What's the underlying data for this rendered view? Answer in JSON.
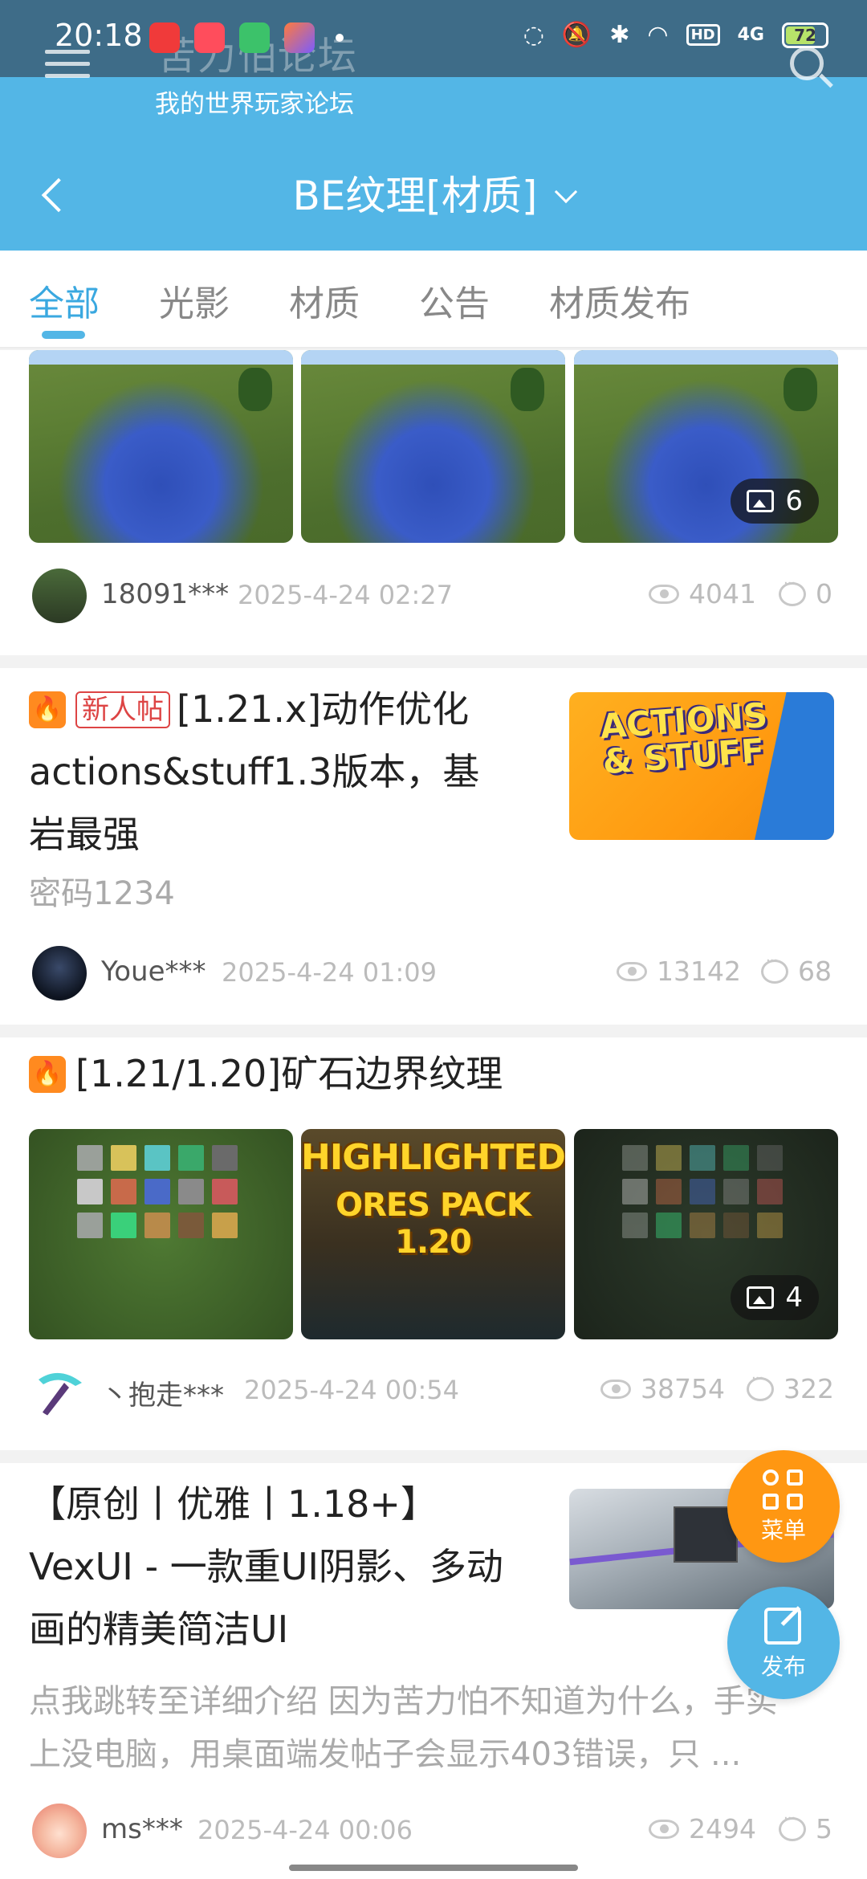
{
  "status_bar": {
    "time": "20:18",
    "network": "4G",
    "hd": "HD",
    "battery": "72"
  },
  "app_header": {
    "title": "苦力怕论坛",
    "subtitle": "我的世界玩家论坛"
  },
  "board": {
    "title": "BE纹理[材质]"
  },
  "tabs": [
    {
      "label": "全部",
      "active": true
    },
    {
      "label": "光影",
      "active": false
    },
    {
      "label": "材质",
      "active": false
    },
    {
      "label": "公告",
      "active": false
    },
    {
      "label": "材质发布",
      "active": false
    }
  ],
  "posts": [
    {
      "image_count": "6",
      "author": "18091***",
      "time": "2025-4-24 02:27",
      "views": "4041",
      "comments": "0"
    },
    {
      "tag": "新人帖",
      "title_lines": [
        "[1.21.x]动作优化",
        "actions&stuff1.3版本，基",
        "岩最强"
      ],
      "excerpt": "密码1234",
      "thumb_text": [
        "ACTIONS",
        "& STUFF"
      ],
      "author": "Youe***",
      "time": "2025-4-24 01:09",
      "views": "13142",
      "comments": "68"
    },
    {
      "title": "[1.21/1.20]矿石边界纹理",
      "thumb_text": [
        "HIGHLIGHTED",
        "ORES PACK 1.20"
      ],
      "image_count": "4",
      "author": "丶抱走***",
      "time": "2025-4-24 00:54",
      "views": "38754",
      "comments": "322"
    },
    {
      "title_lines": [
        "【原创丨优雅丨1.18+】",
        "VexUI - 一款重UI阴影、多动",
        "画的精美简洁UI"
      ],
      "excerpt_lines": [
        "点我跳转至详细介绍 因为苦力怕不知道为什么，手实",
        "上没电脑，用桌面端发帖子会显示403错误，只 ..."
      ],
      "author": "ms***",
      "time": "2025-4-24 00:06",
      "views": "2494",
      "comments": "5"
    }
  ],
  "fab": {
    "menu_label": "菜单",
    "post_label": "发布"
  },
  "colors": {
    "primary": "#53b6e6",
    "accent_orange": "#ff9712",
    "status_bar": "#3e6c88"
  }
}
